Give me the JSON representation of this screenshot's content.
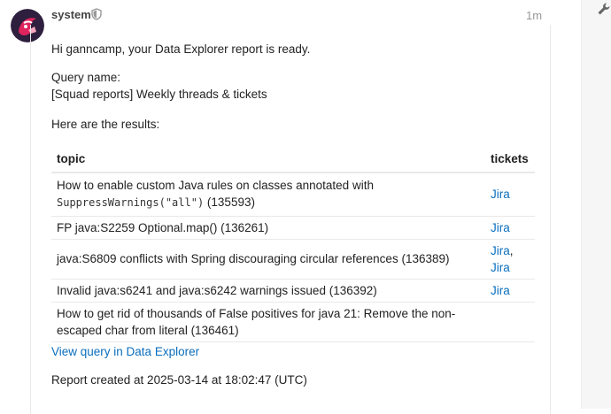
{
  "post": {
    "username": "system",
    "time": "1m"
  },
  "message": {
    "greeting": "Hi ganncamp, your Data Explorer report is ready.",
    "query_label": "Query name:",
    "query_name": "[Squad reports] Weekly threads & tickets",
    "results_label": "Here are the results:"
  },
  "table": {
    "headers": [
      "topic",
      "tickets"
    ],
    "rows": [
      {
        "topic": "How to enable custom Java rules on classes annotated with",
        "code": "SuppressWarnings(\"all\")",
        "topic_suffix": " (135593)",
        "tickets": [
          "Jira"
        ]
      },
      {
        "topic": "FP java:S2259 Optional.map() (136261)",
        "tickets": [
          "Jira"
        ]
      },
      {
        "topic": "java:S6809 conflicts with Spring discouraging circular references (136389)",
        "tickets": [
          "Jira",
          "Jira"
        ],
        "separator": ","
      },
      {
        "topic": "Invalid java:s6241 and java:s6242 warnings issued (136392)",
        "tickets": [
          "Jira"
        ]
      },
      {
        "topic": "How to get rid of thousands of False positives for java 21: Remove the non-escaped char from literal (136461)",
        "tickets": []
      }
    ]
  },
  "footer": {
    "view_link": "View query in Data Explorer",
    "report_created": "Report created at 2025-03-14 at 18:02:47 (UTC)"
  },
  "colors": {
    "link": "#0a6ebd",
    "avatar_bg": "#2d1f3d",
    "avatar_accent": "#e0245e"
  },
  "icons": [
    "avatar-logo",
    "shield-icon",
    "wrench-icon"
  ]
}
